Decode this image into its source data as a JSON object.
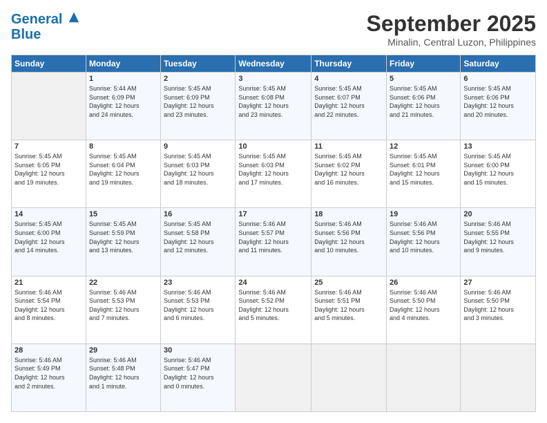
{
  "header": {
    "logo_line1": "General",
    "logo_line2": "Blue",
    "month": "September 2025",
    "location": "Minalin, Central Luzon, Philippines"
  },
  "columns": [
    "Sunday",
    "Monday",
    "Tuesday",
    "Wednesday",
    "Thursday",
    "Friday",
    "Saturday"
  ],
  "weeks": [
    [
      {
        "day": "",
        "info": ""
      },
      {
        "day": "1",
        "info": "Sunrise: 5:44 AM\nSunset: 6:09 PM\nDaylight: 12 hours\nand 24 minutes."
      },
      {
        "day": "2",
        "info": "Sunrise: 5:45 AM\nSunset: 6:09 PM\nDaylight: 12 hours\nand 23 minutes."
      },
      {
        "day": "3",
        "info": "Sunrise: 5:45 AM\nSunset: 6:08 PM\nDaylight: 12 hours\nand 23 minutes."
      },
      {
        "day": "4",
        "info": "Sunrise: 5:45 AM\nSunset: 6:07 PM\nDaylight: 12 hours\nand 22 minutes."
      },
      {
        "day": "5",
        "info": "Sunrise: 5:45 AM\nSunset: 6:06 PM\nDaylight: 12 hours\nand 21 minutes."
      },
      {
        "day": "6",
        "info": "Sunrise: 5:45 AM\nSunset: 6:06 PM\nDaylight: 12 hours\nand 20 minutes."
      }
    ],
    [
      {
        "day": "7",
        "info": "Sunrise: 5:45 AM\nSunset: 6:05 PM\nDaylight: 12 hours\nand 19 minutes."
      },
      {
        "day": "8",
        "info": "Sunrise: 5:45 AM\nSunset: 6:04 PM\nDaylight: 12 hours\nand 19 minutes."
      },
      {
        "day": "9",
        "info": "Sunrise: 5:45 AM\nSunset: 6:03 PM\nDaylight: 12 hours\nand 18 minutes."
      },
      {
        "day": "10",
        "info": "Sunrise: 5:45 AM\nSunset: 6:03 PM\nDaylight: 12 hours\nand 17 minutes."
      },
      {
        "day": "11",
        "info": "Sunrise: 5:45 AM\nSunset: 6:02 PM\nDaylight: 12 hours\nand 16 minutes."
      },
      {
        "day": "12",
        "info": "Sunrise: 5:45 AM\nSunset: 6:01 PM\nDaylight: 12 hours\nand 15 minutes."
      },
      {
        "day": "13",
        "info": "Sunrise: 5:45 AM\nSunset: 6:00 PM\nDaylight: 12 hours\nand 15 minutes."
      }
    ],
    [
      {
        "day": "14",
        "info": "Sunrise: 5:45 AM\nSunset: 6:00 PM\nDaylight: 12 hours\nand 14 minutes."
      },
      {
        "day": "15",
        "info": "Sunrise: 5:45 AM\nSunset: 5:59 PM\nDaylight: 12 hours\nand 13 minutes."
      },
      {
        "day": "16",
        "info": "Sunrise: 5:45 AM\nSunset: 5:58 PM\nDaylight: 12 hours\nand 12 minutes."
      },
      {
        "day": "17",
        "info": "Sunrise: 5:46 AM\nSunset: 5:57 PM\nDaylight: 12 hours\nand 11 minutes."
      },
      {
        "day": "18",
        "info": "Sunrise: 5:46 AM\nSunset: 5:56 PM\nDaylight: 12 hours\nand 10 minutes."
      },
      {
        "day": "19",
        "info": "Sunrise: 5:46 AM\nSunset: 5:56 PM\nDaylight: 12 hours\nand 10 minutes."
      },
      {
        "day": "20",
        "info": "Sunrise: 5:46 AM\nSunset: 5:55 PM\nDaylight: 12 hours\nand 9 minutes."
      }
    ],
    [
      {
        "day": "21",
        "info": "Sunrise: 5:46 AM\nSunset: 5:54 PM\nDaylight: 12 hours\nand 8 minutes."
      },
      {
        "day": "22",
        "info": "Sunrise: 5:46 AM\nSunset: 5:53 PM\nDaylight: 12 hours\nand 7 minutes."
      },
      {
        "day": "23",
        "info": "Sunrise: 5:46 AM\nSunset: 5:53 PM\nDaylight: 12 hours\nand 6 minutes."
      },
      {
        "day": "24",
        "info": "Sunrise: 5:46 AM\nSunset: 5:52 PM\nDaylight: 12 hours\nand 5 minutes."
      },
      {
        "day": "25",
        "info": "Sunrise: 5:46 AM\nSunset: 5:51 PM\nDaylight: 12 hours\nand 5 minutes."
      },
      {
        "day": "26",
        "info": "Sunrise: 5:46 AM\nSunset: 5:50 PM\nDaylight: 12 hours\nand 4 minutes."
      },
      {
        "day": "27",
        "info": "Sunrise: 5:46 AM\nSunset: 5:50 PM\nDaylight: 12 hours\nand 3 minutes."
      }
    ],
    [
      {
        "day": "28",
        "info": "Sunrise: 5:46 AM\nSunset: 5:49 PM\nDaylight: 12 hours\nand 2 minutes."
      },
      {
        "day": "29",
        "info": "Sunrise: 5:46 AM\nSunset: 5:48 PM\nDaylight: 12 hours\nand 1 minute."
      },
      {
        "day": "30",
        "info": "Sunrise: 5:46 AM\nSunset: 5:47 PM\nDaylight: 12 hours\nand 0 minutes."
      },
      {
        "day": "",
        "info": ""
      },
      {
        "day": "",
        "info": ""
      },
      {
        "day": "",
        "info": ""
      },
      {
        "day": "",
        "info": ""
      }
    ]
  ]
}
